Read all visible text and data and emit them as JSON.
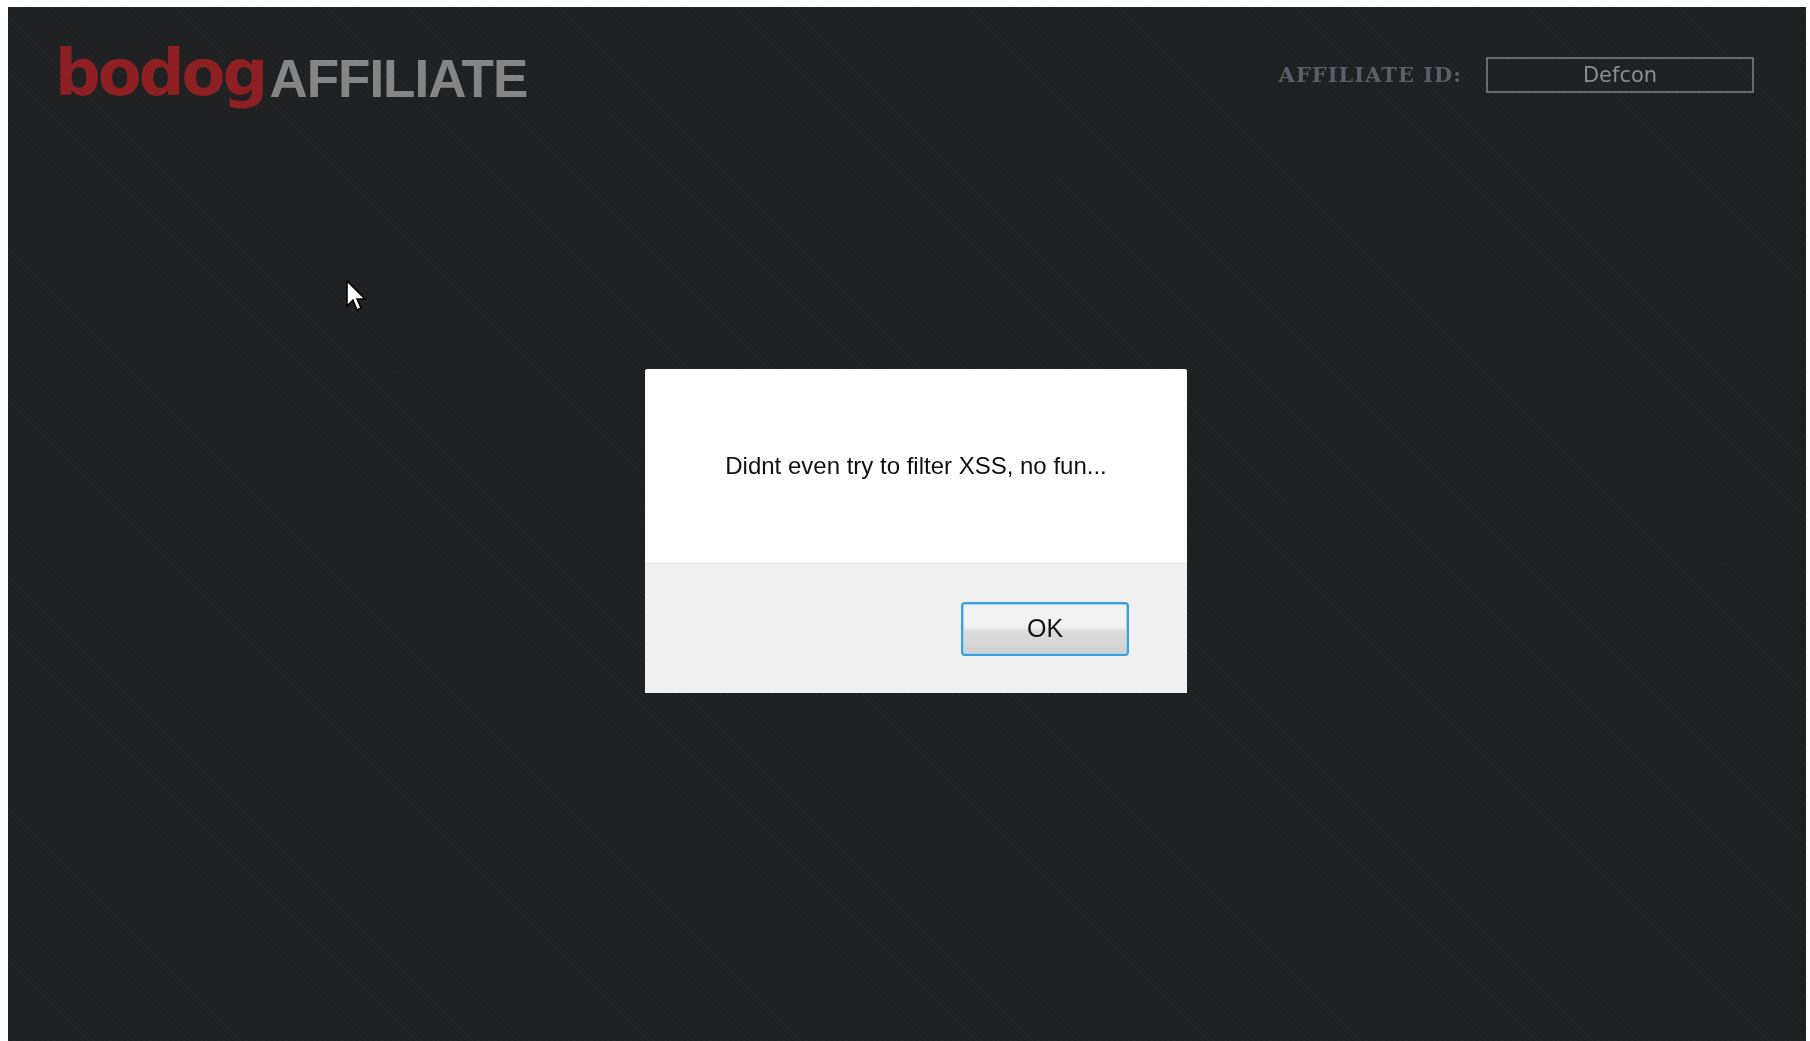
{
  "header": {
    "logo_brand": "bodog",
    "logo_product": "AFFILIATE",
    "affiliate_id_label": "AFFILIATE ID:",
    "affiliate_id_value": "Defcon"
  },
  "alert": {
    "message": "Didnt even try to filter XSS, no fun...",
    "button": "OK",
    "button_focused": true
  }
}
